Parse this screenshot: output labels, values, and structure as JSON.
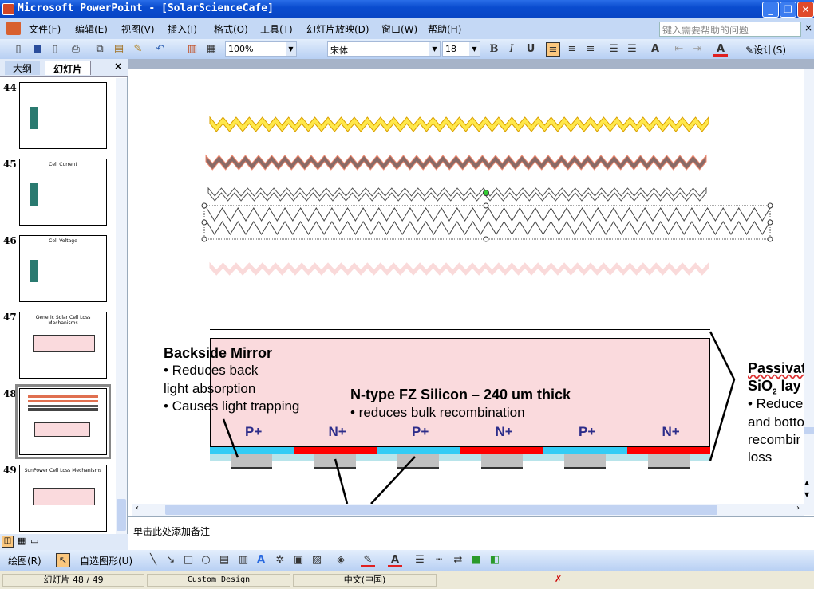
{
  "window": {
    "title": "Microsoft PowerPoint - [SolarScienceCafe]",
    "minimize": "_",
    "restore": "❐",
    "close": "✕"
  },
  "menu": {
    "items": [
      "文件(F)",
      "编辑(E)",
      "视图(V)",
      "插入(I)",
      "格式(O)",
      "工具(T)",
      "幻灯片放映(D)",
      "窗口(W)",
      "帮助(H)"
    ],
    "help_placeholder": "键入需要帮助的问题"
  },
  "toolbar": {
    "zoom": "100%",
    "font": "宋体",
    "font_size": "18",
    "bold": "B",
    "italic": "I",
    "underline": "U",
    "design": "设计(S)"
  },
  "panel": {
    "tabs": [
      "大纲",
      "幻灯片"
    ],
    "close": "×"
  },
  "slides": [
    {
      "num": "44",
      "title": ""
    },
    {
      "num": "45",
      "title": "Cell Current"
    },
    {
      "num": "46",
      "title": "Cell Voltage"
    },
    {
      "num": "47",
      "title": "Generic Solar Cell Loss Mechanisms"
    },
    {
      "num": "48",
      "title": "",
      "selected": true
    },
    {
      "num": "49",
      "title": "SunPower Cell Loss Mechanisms"
    }
  ],
  "slide": {
    "zigzags": [
      {
        "fill": "#ffe84a",
        "stroke": "#d9a000"
      },
      {
        "fill": "#8a6a66",
        "stroke": "#f08a70"
      },
      {
        "fill": "none",
        "stroke": "#555"
      },
      {
        "fill": "none",
        "stroke": "#444"
      },
      {
        "fill": "#fadada",
        "stroke": "#fadada"
      }
    ],
    "backside": {
      "title": "Backside Mirror",
      "b1": "• Reduces back",
      "b1b": "light absorption",
      "b2": "• Causes light trapping"
    },
    "silicon": {
      "title": "N-type FZ Silicon – 240 um thick",
      "b1": "• reduces bulk recombination"
    },
    "passivation": {
      "title": "Passivat",
      "sio": "SiO",
      "sub": "2",
      "lay": " lay",
      "b1": "• Reduce",
      "b2": "and botto",
      "b3": "recombir",
      "b4": "loss"
    },
    "regions": [
      "P+",
      "N+",
      "P+",
      "N+",
      "P+",
      "N+"
    ],
    "colors": {
      "wafer": "#fadadd",
      "p": "#33ccf5",
      "n": "#ff0000",
      "oxide": "#b8e4ea",
      "contact": "#c0c0c0"
    }
  },
  "notes": {
    "placeholder": "单击此处添加备注"
  },
  "drawing": {
    "draw": "绘图(R)",
    "autoshapes": "自选图形(U)"
  },
  "status": {
    "slide": "幻灯片 48 / 49",
    "design": "Custom Design",
    "lang": "中文(中国)"
  }
}
